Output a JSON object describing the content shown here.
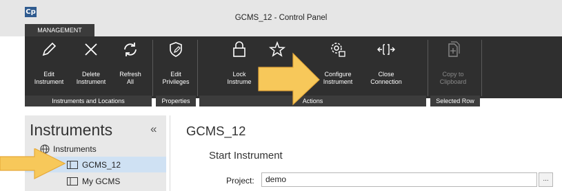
{
  "window": {
    "app_icon_text": "Cp",
    "title": "GCMS_12 - Control Panel"
  },
  "tabs": [
    {
      "label": "MANAGEMENT"
    }
  ],
  "ribbon": {
    "groups": [
      {
        "label": "Instruments and Locations"
      },
      {
        "label": "Properties"
      },
      {
        "label": "Actions"
      },
      {
        "label": "Selected Row"
      }
    ],
    "buttons": {
      "edit_instrument": "Edit\nInstrument",
      "delete_instrument": "Delete\nInstrument",
      "refresh_all": "Refresh\nAll",
      "edit_privileges": "Edit\nPrivileges",
      "lock_instrument": "Lock\nInstrume",
      "configure_instrument": "Configure\nInstrument",
      "close_connection": "Close\nConnection",
      "copy_to_clipboard": "Copy to\nClipboard"
    }
  },
  "sidebar": {
    "title": "Instruments",
    "collapse_glyph": "«",
    "root": "Instruments",
    "items": [
      {
        "label": "GCMS_12",
        "selected": true
      },
      {
        "label": "My GCMS",
        "selected": false
      }
    ]
  },
  "main": {
    "title": "GCMS_12",
    "section": "Start Instrument",
    "project": {
      "label": "Project:",
      "value": "demo",
      "browse_label": "..."
    }
  },
  "colors": {
    "ribbon_bg": "#2f2f2f",
    "highlight_arrow": "#f7c85a",
    "selection": "#cfe1f3"
  }
}
